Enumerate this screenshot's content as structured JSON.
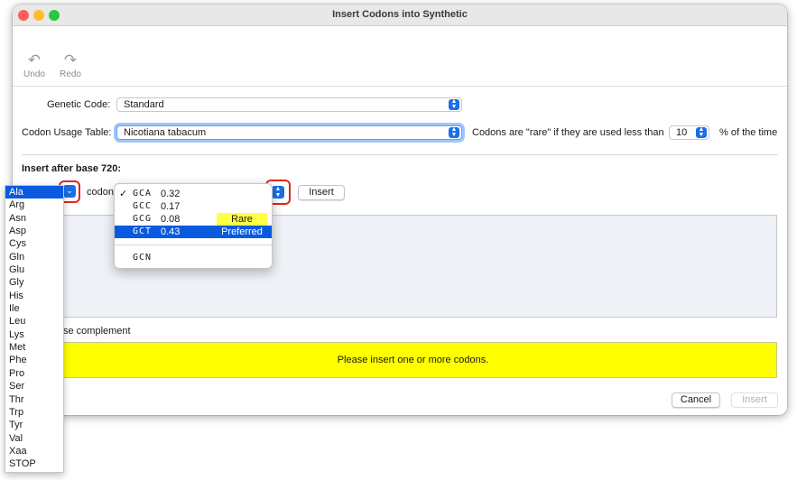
{
  "window": {
    "title": "Insert Codons into Synthetic"
  },
  "toolbar": {
    "undo_label": "Undo",
    "redo_label": "Redo"
  },
  "form": {
    "genetic_code_label": "Genetic Code:",
    "genetic_code_value": "Standard",
    "codon_usage_label": "Codon Usage Table:",
    "codon_usage_value": "Nicotiana tabacum",
    "rare_prefix": "Codons are \"rare\" if they are used less than",
    "rare_threshold": "10",
    "rare_suffix": "% of the time",
    "insert_after_label": "Insert after base 720:",
    "codon_word": "codon",
    "insert_button": "Insert",
    "reverse_complement_label": "se complement"
  },
  "amino_acids": {
    "selected": "Ala",
    "items": [
      "Ala",
      "Arg",
      "Asn",
      "Asp",
      "Cys",
      "Gln",
      "Glu",
      "Gly",
      "His",
      "Ile",
      "Leu",
      "Lys",
      "Met",
      "Phe",
      "Pro",
      "Ser",
      "Thr",
      "Trp",
      "Tyr",
      "Val",
      "Xaa",
      "STOP"
    ]
  },
  "codon_menu": {
    "rows": [
      {
        "codon": "GCA",
        "freq": "0.32",
        "tag": "",
        "checked": true
      },
      {
        "codon": "GCC",
        "freq": "0.17",
        "tag": ""
      },
      {
        "codon": "GCG",
        "freq": "0.08",
        "tag": "Rare"
      },
      {
        "codon": "GCT",
        "freq": "0.43",
        "tag": "Preferred",
        "highlighted": true
      }
    ],
    "degenerate": "GCN",
    "checkmark": "✓"
  },
  "status_message": "Please insert one or more codons.",
  "footer": {
    "cancel_label": "Cancel",
    "insert_label": "Insert"
  },
  "colors": {
    "accent": "#1a6fe8",
    "selection": "#0a5ae0",
    "status_background": "#ffff00",
    "rare_highlight": "#ffff44",
    "annotation_ring": "#e0261a"
  }
}
